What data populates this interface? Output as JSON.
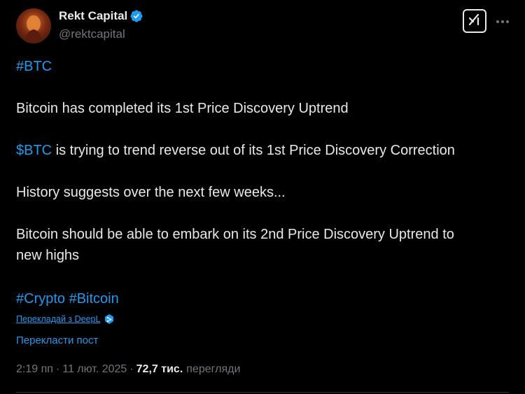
{
  "author": {
    "name": "Rekt Capital",
    "handle": "@rektcapital",
    "verified_color": "#1d9bf0"
  },
  "icons": {
    "grok": "grok-icon",
    "more": "more-horizontal-icon",
    "deepl": "deepl-icon"
  },
  "post": {
    "hashtag_top": "#BTC",
    "line1": "Bitcoin has completed its 1st Price Discovery Uptrend",
    "line2_cashtag": "$BTC",
    "line2_rest": " is trying to trend reverse out of its 1st Price Discovery Correction",
    "line3": "History suggests over the next few weeks...",
    "line4a": "Bitcoin should be able to embark on its 2nd Price Discovery Uptrend to",
    "line4b": "new highs",
    "hashtag_crypto": "#Crypto",
    "hashtag_bitcoin": "#Bitcoin"
  },
  "translate": {
    "deepl_label": "Перекладай з DeepL",
    "translate_post": "Перекласти пост"
  },
  "meta": {
    "time": "2:19 пп",
    "sep1": "·",
    "date": "11 лют. 2025",
    "sep2": "·",
    "views_count": "72,7 тис.",
    "views_label": "перегляди"
  },
  "colors": {
    "background": "#000000",
    "text": "#e7e9ea",
    "secondary": "#71767b",
    "link": "#1d9bf0"
  }
}
